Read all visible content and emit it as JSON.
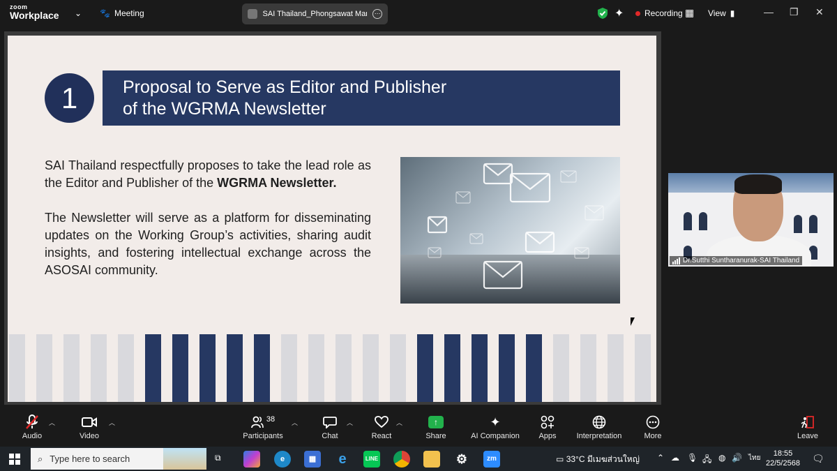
{
  "topbar": {
    "logo_top": "zoom",
    "logo_bottom": "Workplace",
    "meeting_label": "Meeting",
    "share_tab_title": "SAI Thailand_Phongsawat Maneer",
    "recording_label": "Recording",
    "view_label": "View"
  },
  "slide": {
    "number": "1",
    "title_line1": "Proposal to Serve as Editor and Publisher",
    "title_line2": "of the WGRMA Newsletter",
    "para1_plain": "SAI Thailand respectfully proposes to take the lead role as the Editor and Publisher of the ",
    "para1_bold": "WGRMA Newsletter.",
    "para2": "The Newsletter will serve as a platform for disseminating updates on the Working Group’s activities, sharing audit insights, and fostering intellectual exchange across the ASOSAI community.",
    "colors": {
      "navy": "#263862",
      "background": "#f2ece9",
      "stripe_light": "#d9d9dd"
    }
  },
  "video": {
    "participant_name": "Dr.Sutthi Suntharanurak-SAI Thailand"
  },
  "toolbar": {
    "audio": "Audio",
    "video": "Video",
    "participants": "Participants",
    "participants_count": "38",
    "chat": "Chat",
    "react": "React",
    "share": "Share",
    "ai_companion": "AI Companion",
    "apps": "Apps",
    "interpretation": "Interpretation",
    "more": "More",
    "leave": "Leave"
  },
  "taskbar": {
    "search_placeholder": "Type here to search",
    "weather": "33°C  มีเมฆส่วนใหญ่",
    "language": "ไทย",
    "time": "18:55",
    "date": "22/5/2568"
  }
}
